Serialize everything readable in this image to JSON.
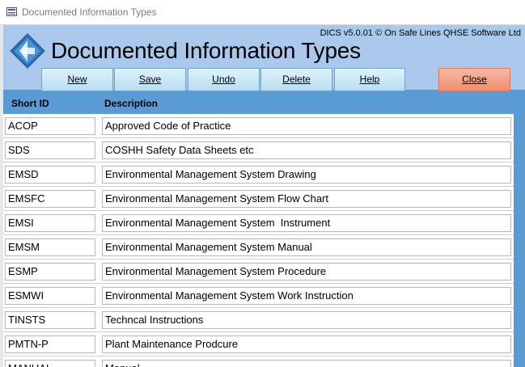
{
  "window": {
    "title": "Documented Information Types"
  },
  "header": {
    "version": "DICS v5.0.01 © On Safe Lines QHSE Software Ltd",
    "title": "Documented Information Types"
  },
  "toolbar": {
    "new_label": "New",
    "save_label": "Save",
    "undo_label": "Undo",
    "delete_label": "Delete",
    "help_label": "Help",
    "close_label": "Close"
  },
  "columns": {
    "short_id": "Short ID",
    "description": "Description"
  },
  "rows": [
    {
      "id": "ACOP",
      "description": "Approved Code of Practice"
    },
    {
      "id": "SDS",
      "description": "COSHH Safety Data Sheets etc"
    },
    {
      "id": "EMSD",
      "description": "Environmental Management System Drawing"
    },
    {
      "id": "EMSFC",
      "description": "Environmental Management System Flow Chart"
    },
    {
      "id": "EMSI",
      "description": "Environmental Management System  Instrument"
    },
    {
      "id": "EMSM",
      "description": "Environmental Management System Manual"
    },
    {
      "id": "ESMP",
      "description": "Environmental Management System Procedure"
    },
    {
      "id": "ESMWI",
      "description": "Environmental Management System Work Instruction"
    },
    {
      "id": "TINSTS",
      "description": "Techncal Instructions"
    },
    {
      "id": "PMTN-P",
      "description": "Plant Maintenance Prodcure"
    },
    {
      "id": "MANUAL",
      "description": "Manual"
    }
  ],
  "colors": {
    "form_bg": "#5b9bd5",
    "header_bg": "#aac8ec",
    "close_button": "#ef8f70",
    "action_button": "#b8def1"
  },
  "icons": {
    "window": "form-window-icon",
    "logo": "blue-diamond-arrows-logo"
  }
}
